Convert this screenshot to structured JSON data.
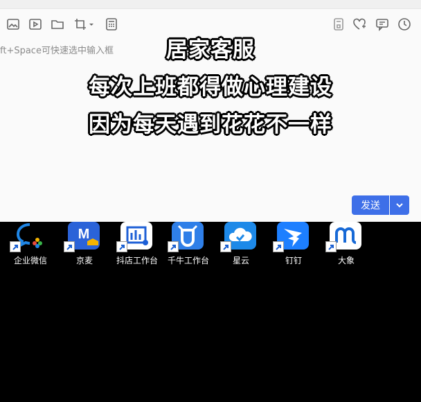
{
  "toolbar_left": [
    {
      "name": "image-icon"
    },
    {
      "name": "video-icon"
    },
    {
      "name": "folder-icon"
    },
    {
      "name": "crop-icon"
    },
    {
      "name": "calculator-icon"
    }
  ],
  "toolbar_right": [
    {
      "name": "save-icon"
    },
    {
      "name": "heart-plus-icon"
    },
    {
      "name": "message-icon"
    },
    {
      "name": "clock-icon"
    }
  ],
  "input": {
    "hint": "ft+Space可快速选中输入框"
  },
  "caption": {
    "line1": "居家客服",
    "line2": "每次上班都得做心理建设",
    "line3": "因为每天遇到花花不一样"
  },
  "send": {
    "label": "发送"
  },
  "desktop": {
    "icons": [
      {
        "label": "企业微信",
        "color": "#1f86e6"
      },
      {
        "label": "京麦",
        "color": "#2b63d8"
      },
      {
        "label": "抖店工作台",
        "color": "#ffffff"
      },
      {
        "label": "千牛工作台",
        "color": "#2f7fe8"
      },
      {
        "label": "星云",
        "color": "#1d89e8"
      },
      {
        "label": "钉钉",
        "color": "#1d7fff"
      },
      {
        "label": "大象",
        "color": "#ffffff"
      }
    ]
  }
}
